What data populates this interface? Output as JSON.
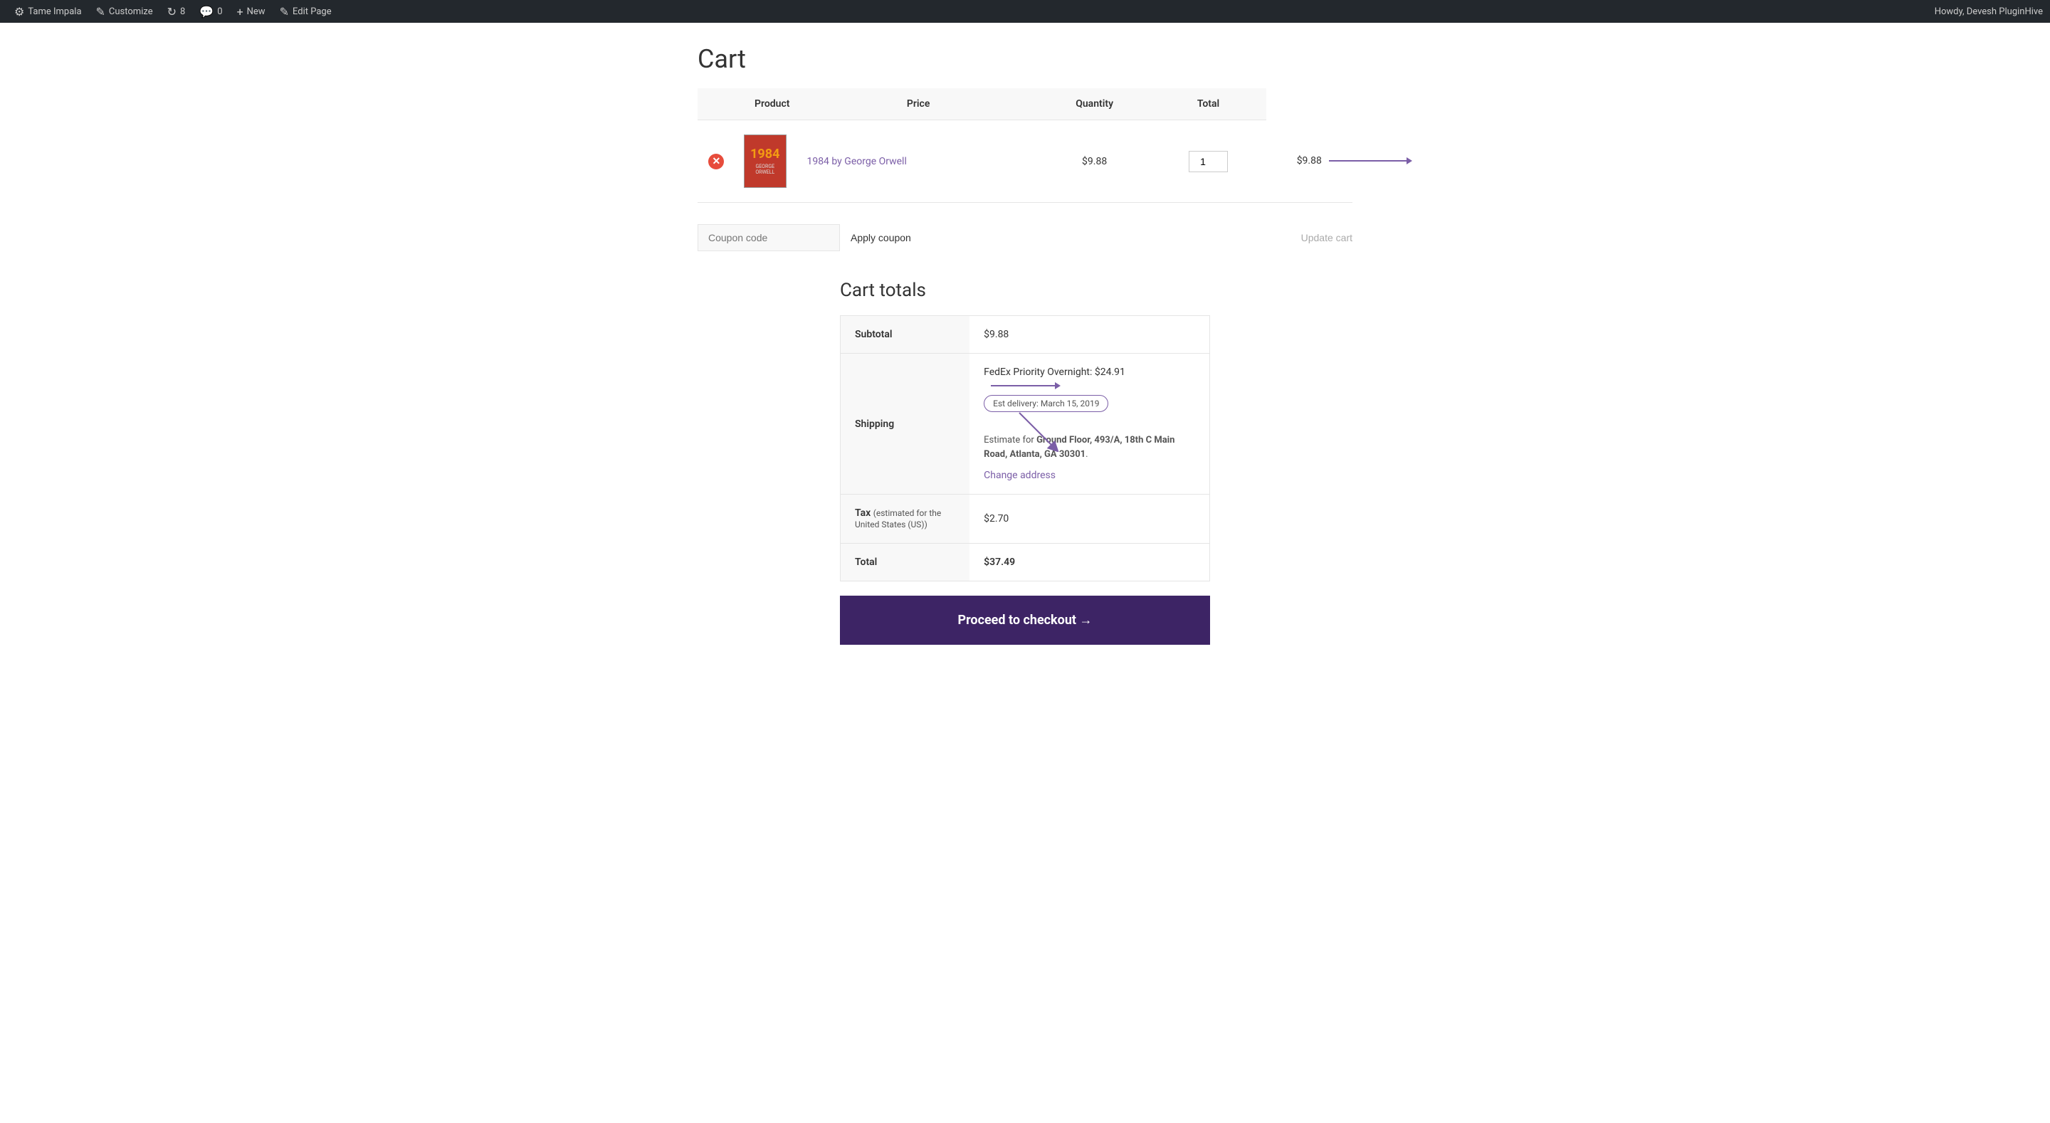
{
  "adminbar": {
    "site_name": "Tame Impala",
    "customize_label": "Customize",
    "updates_count": "8",
    "comments_count": "0",
    "new_label": "New",
    "edit_page_label": "Edit Page",
    "user_greeting": "Howdy, Devesh PluginHive"
  },
  "page": {
    "title": "Cart"
  },
  "cart_table": {
    "headers": {
      "product": "Product",
      "price": "Price",
      "quantity": "Quantity",
      "total": "Total"
    },
    "items": [
      {
        "name": "1984 by George Orwell",
        "price": "$9.88",
        "quantity": "1",
        "total": "$9.88"
      }
    ]
  },
  "coupon": {
    "placeholder": "Coupon code",
    "apply_label": "Apply coupon",
    "update_label": "Update cart"
  },
  "cart_totals": {
    "title": "Cart totals",
    "subtotal_label": "Subtotal",
    "subtotal_value": "$9.88",
    "shipping_label": "Shipping",
    "shipping_method": "FedEx Priority Overnight: $24.91",
    "est_delivery": "Est delivery: March 15, 2019",
    "estimate_prefix": "Estimate for ",
    "estimate_address": "Ground Floor, 493/A, 18th C Main Road, Atlanta, GA 30301",
    "change_address": "Change address",
    "tax_label": "Tax",
    "tax_note": "(estimated for the United States (US))",
    "tax_value": "$2.70",
    "total_label": "Total",
    "total_value": "$37.49"
  },
  "checkout": {
    "button_label": "Proceed to checkout →"
  }
}
